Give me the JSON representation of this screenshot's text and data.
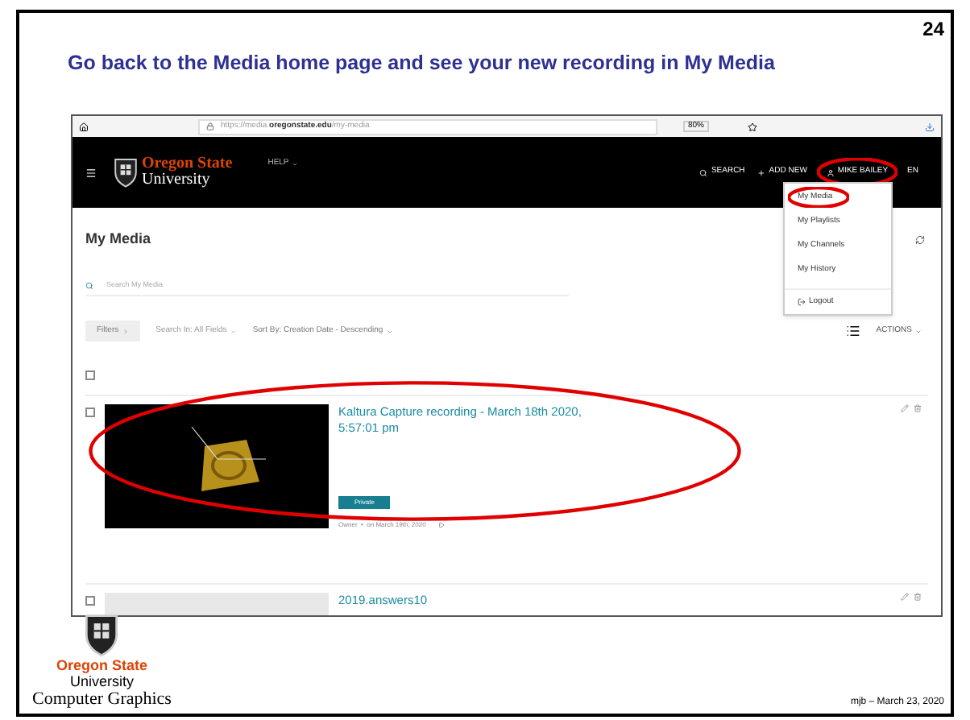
{
  "slide": {
    "page_number": "24",
    "title": "Go back to the Media home page and see your new recording in My Media",
    "footer_logo_line1": "Oregon State",
    "footer_logo_line2": "University",
    "footer_caption": "Computer Graphics",
    "footer_note": "mjb – March 23, 2020"
  },
  "browser": {
    "url_prefix": "https://media.",
    "url_domain": "oregonstate.edu",
    "url_path": "/my-media",
    "zoom": "80%"
  },
  "header": {
    "logo_line1": "Oregon State",
    "logo_line2": "University",
    "help": "HELP",
    "search": "SEARCH",
    "add_new": "ADD NEW",
    "user": "MIKE BAILEY",
    "user_highlighted": true,
    "language": "EN"
  },
  "user_menu": {
    "items": [
      {
        "label": "My Media",
        "kind": "link",
        "highlighted": true
      },
      {
        "label": "My Playlists",
        "kind": "link",
        "highlighted": false
      },
      {
        "label": "My Channels",
        "kind": "link",
        "highlighted": false
      },
      {
        "label": "My History",
        "kind": "link",
        "highlighted": false
      },
      {
        "label": "Logout",
        "kind": "logout",
        "highlighted": false
      }
    ]
  },
  "page": {
    "title": "My Media",
    "search_placeholder": "Search My Media",
    "filters": "Filters",
    "search_in": "Search In: All Fields",
    "sort_by": "Sort By: Creation Date - Descending",
    "actions": "ACTIONS",
    "select_all_checked": false
  },
  "entries": [
    {
      "title": "Kaltura Capture recording - March 18th 2020, 5:57:01 pm",
      "kind": "video",
      "checked": false,
      "badge": "Private",
      "meta": "Owner  •  on March 19th, 2020",
      "highlighted": true
    },
    {
      "title": "2019.answers10",
      "kind": "document",
      "checked": false,
      "highlighted": false
    }
  ]
}
